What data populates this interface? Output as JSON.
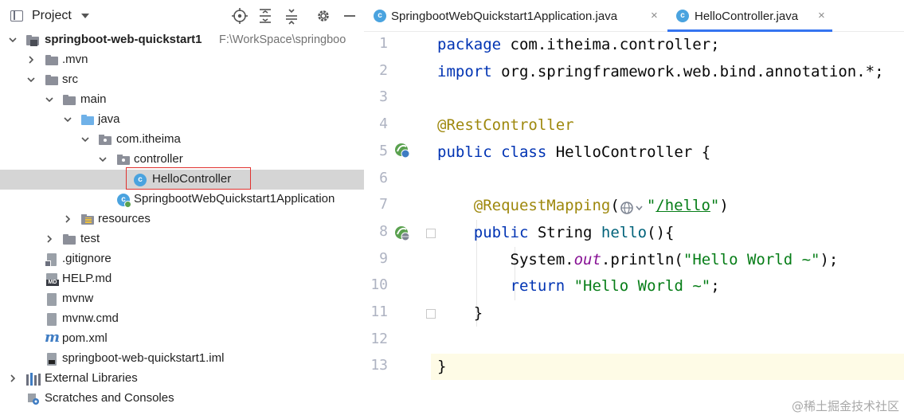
{
  "project_panel": {
    "title": "Project",
    "tools": [
      "locate-icon",
      "expand-all-icon",
      "collapse-all-icon",
      "gear-icon",
      "minimize-icon"
    ],
    "tree": [
      {
        "label": "springboot-web-quickstart1",
        "path": "F:\\WorkSpace\\springboo",
        "bold": true,
        "icon": "module-icon",
        "chevron": "down"
      },
      {
        "label": ".mvn",
        "icon": "folder-icon",
        "chevron": "right"
      },
      {
        "label": "src",
        "icon": "folder-icon",
        "chevron": "down"
      },
      {
        "label": "main",
        "icon": "folder-icon",
        "chevron": "down"
      },
      {
        "label": "java",
        "icon": "source-folder-icon",
        "chevron": "down"
      },
      {
        "label": "com.itheima",
        "icon": "package-icon",
        "chevron": "down"
      },
      {
        "label": "controller",
        "icon": "package-icon",
        "chevron": "down"
      },
      {
        "label": "HelloController",
        "icon": "class-icon",
        "selected": true
      },
      {
        "label": "SpringbootWebQuickstart1Application",
        "icon": "spring-boot-class-icon"
      },
      {
        "label": "resources",
        "icon": "resources-folder-icon",
        "chevron": "right"
      },
      {
        "label": "test",
        "icon": "folder-icon",
        "chevron": "right"
      },
      {
        "label": ".gitignore",
        "icon": "gitignore-file-icon"
      },
      {
        "label": "HELP.md",
        "icon": "markdown-file-icon"
      },
      {
        "label": "mvnw",
        "icon": "file-icon"
      },
      {
        "label": "mvnw.cmd",
        "icon": "file-icon"
      },
      {
        "label": "pom.xml",
        "icon": "maven-icon"
      },
      {
        "label": "springboot-web-quickstart1.iml",
        "icon": "iml-file-icon"
      },
      {
        "label": "External Libraries",
        "icon": "libraries-icon",
        "chevron": "right"
      },
      {
        "label": "Scratches and Consoles",
        "icon": "scratches-icon"
      }
    ]
  },
  "editor": {
    "tabs": [
      {
        "label": "SpringbootWebQuickstart1Application.java",
        "close": "×",
        "active": false
      },
      {
        "label": "HelloController.java",
        "close": "×",
        "active": true
      }
    ],
    "current_line": 13,
    "lines": [
      {
        "num": "1",
        "tokens": [
          [
            "kw",
            "package"
          ],
          [
            "plain",
            " com.itheima.controller;"
          ]
        ]
      },
      {
        "num": "2",
        "tokens": [
          [
            "kw",
            "import"
          ],
          [
            "plain",
            " org.springframework.web.bind.annotation.*;"
          ]
        ]
      },
      {
        "num": "3",
        "tokens": []
      },
      {
        "num": "4",
        "tokens": [
          [
            "ann",
            "@RestController"
          ]
        ]
      },
      {
        "num": "5",
        "tokens": [
          [
            "kw",
            "public class"
          ],
          [
            "plain",
            " HelloController {"
          ]
        ]
      },
      {
        "num": "6",
        "tokens": []
      },
      {
        "num": "7",
        "tokens": [
          [
            "plain",
            "    "
          ],
          [
            "ann",
            "@RequestMapping"
          ],
          [
            "plain",
            "("
          ],
          [
            "inlay",
            ""
          ],
          [
            "str",
            "\""
          ],
          [
            "str-url",
            "/hello"
          ],
          [
            "str",
            "\""
          ],
          [
            "plain",
            ")"
          ]
        ]
      },
      {
        "num": "8",
        "tokens": [
          [
            "plain",
            "    "
          ],
          [
            "kw",
            "public"
          ],
          [
            "plain",
            " String "
          ],
          [
            "method",
            "hello"
          ],
          [
            "plain",
            "(){"
          ]
        ]
      },
      {
        "num": "9",
        "tokens": [
          [
            "plain",
            "        System."
          ],
          [
            "field",
            "out"
          ],
          [
            "plain",
            ".println("
          ],
          [
            "str",
            "\"Hello World ~\""
          ],
          [
            "plain",
            ");"
          ]
        ]
      },
      {
        "num": "10",
        "tokens": [
          [
            "plain",
            "        "
          ],
          [
            "kw",
            "return"
          ],
          [
            "plain",
            " "
          ],
          [
            "str",
            "\"Hello World ~\""
          ],
          [
            "plain",
            ";"
          ]
        ]
      },
      {
        "num": "11",
        "tokens": [
          [
            "plain",
            "    }"
          ]
        ]
      },
      {
        "num": "12",
        "tokens": []
      },
      {
        "num": "13",
        "tokens": [
          [
            "plain",
            "}"
          ]
        ]
      }
    ]
  },
  "watermark": "@稀土掘金技术社区"
}
